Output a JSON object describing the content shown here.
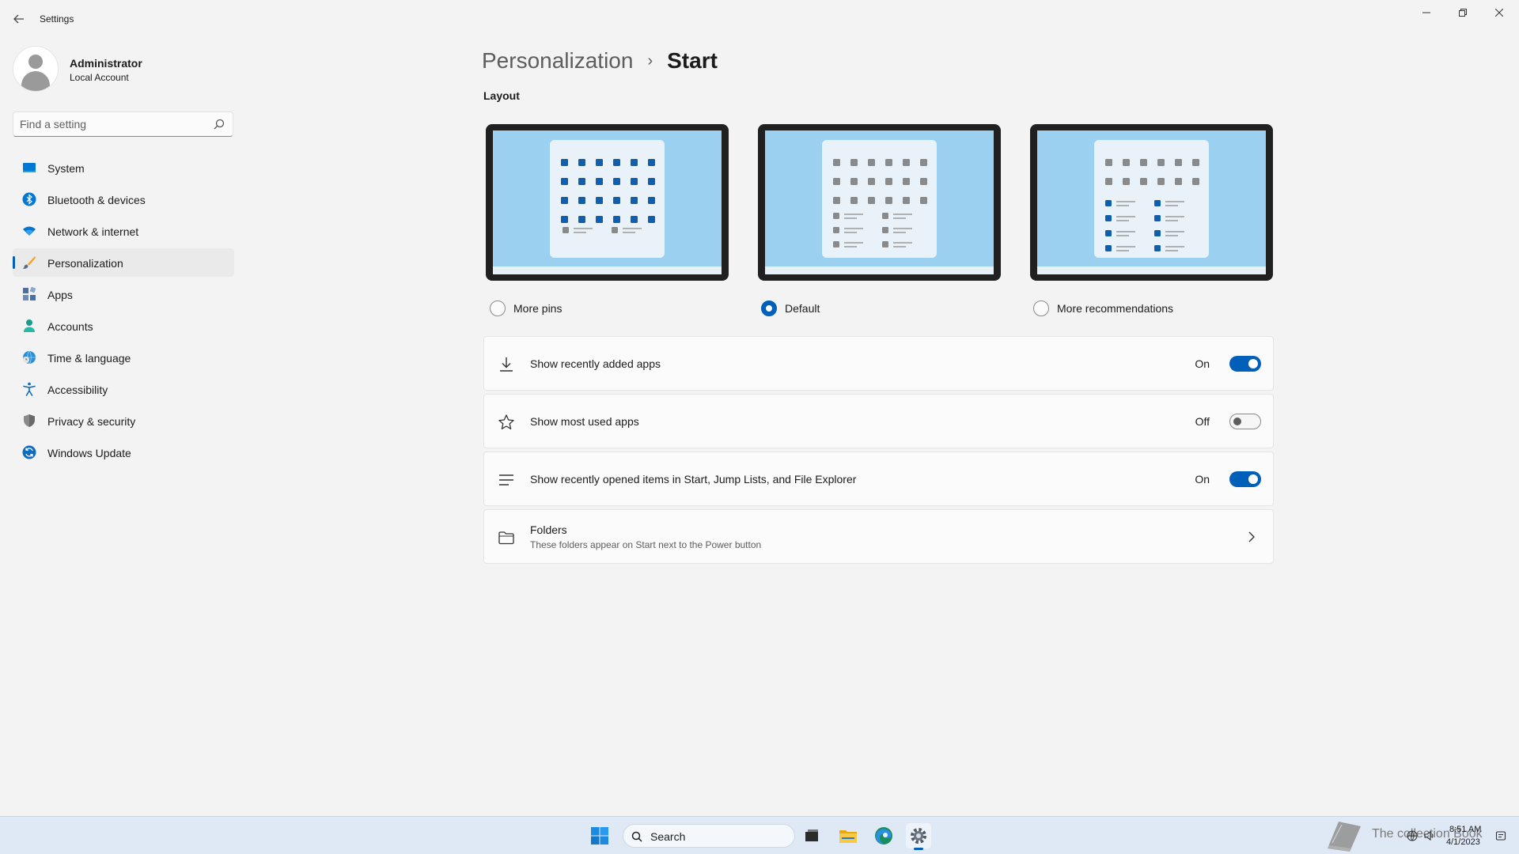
{
  "window": {
    "title": "Settings",
    "controls": {
      "minimize": "—",
      "maximize": "❐",
      "close": "✕"
    }
  },
  "profile": {
    "name": "Administrator",
    "account_type": "Local Account"
  },
  "search": {
    "placeholder": "Find a setting"
  },
  "sidebar": {
    "items": [
      {
        "label": "System",
        "icon": "monitor-icon",
        "color": "#0078d4"
      },
      {
        "label": "Bluetooth & devices",
        "icon": "bluetooth-icon",
        "color": "#0078d4"
      },
      {
        "label": "Network & internet",
        "icon": "wifi-icon",
        "color": "#0078d4"
      },
      {
        "label": "Personalization",
        "icon": "brush-icon",
        "color": "#e8702a",
        "selected": true
      },
      {
        "label": "Apps",
        "icon": "apps-icon",
        "color": "#4a6fa5"
      },
      {
        "label": "Accounts",
        "icon": "person-icon",
        "color": "#1a9b8c"
      },
      {
        "label": "Time & language",
        "icon": "globe-clock-icon",
        "color": "#2a8fd6"
      },
      {
        "label": "Accessibility",
        "icon": "accessibility-icon",
        "color": "#0f6cbd"
      },
      {
        "label": "Privacy & security",
        "icon": "shield-icon",
        "color": "#7a7a7a"
      },
      {
        "label": "Windows Update",
        "icon": "update-icon",
        "color": "#0f6cbd"
      }
    ]
  },
  "main": {
    "breadcrumb": {
      "parent": "Personalization",
      "separator": "›",
      "current": "Start"
    },
    "layout_section": {
      "label": "Layout",
      "options": [
        {
          "label": "More pins",
          "selected": false
        },
        {
          "label": "Default",
          "selected": true
        },
        {
          "label": "More recommendations",
          "selected": false
        }
      ]
    },
    "settings": [
      {
        "label": "Show recently added apps",
        "icon": "download-icon",
        "state_label": "On",
        "on": true
      },
      {
        "label": "Show most used apps",
        "icon": "star-icon",
        "state_label": "Off",
        "on": false
      },
      {
        "label": "Show recently opened items in Start, Jump Lists, and File Explorer",
        "icon": "list-icon",
        "state_label": "On",
        "on": true
      },
      {
        "label": "Folders",
        "description": "These folders appear on Start next to the Power button",
        "icon": "folder-icon"
      }
    ]
  },
  "taskbar": {
    "search_label": "Search",
    "apps": [
      "start-icon",
      "task-view-icon",
      "file-explorer-icon",
      "edge-icon",
      "settings-icon"
    ],
    "tray": {
      "time": "8:51 AM",
      "date": "4/1/2023",
      "watermark": "The collection Book"
    }
  },
  "colors": {
    "accent": "#005fb8",
    "background": "#f3f3f3",
    "card": "#fbfbfb"
  }
}
